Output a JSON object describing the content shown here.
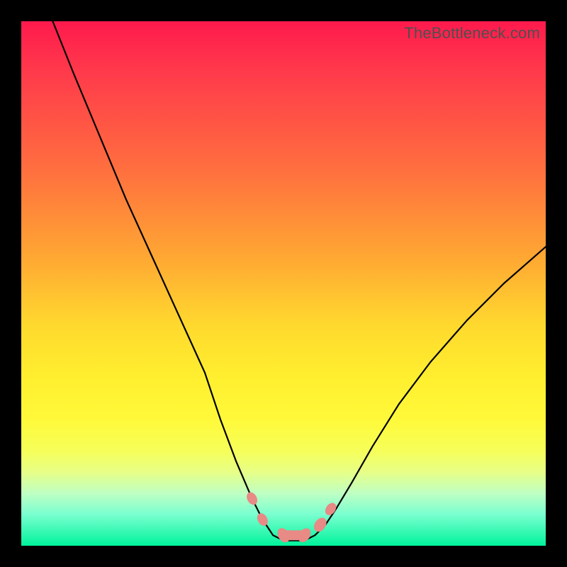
{
  "watermark": "TheBottleneck.com",
  "chart_data": {
    "type": "line",
    "title": "",
    "xlabel": "",
    "ylabel": "",
    "xlim": [
      0,
      100
    ],
    "ylim": [
      0,
      100
    ],
    "series": [
      {
        "name": "bottleneck-curve",
        "x": [
          6,
          10,
          15,
          20,
          25,
          30,
          35,
          38,
          41,
          44,
          46,
          48,
          50,
          52,
          54,
          56,
          58,
          60,
          63,
          67,
          72,
          78,
          85,
          92,
          100
        ],
        "values": [
          100,
          90,
          78,
          66,
          55,
          44,
          33,
          24,
          16,
          9,
          5,
          2,
          1,
          1,
          1,
          2,
          4,
          7,
          12,
          19,
          27,
          35,
          43,
          50,
          57
        ]
      }
    ],
    "markers": {
      "name": "highlight-band",
      "color": "#e88a85",
      "points": [
        {
          "x": 44,
          "y": 9
        },
        {
          "x": 46,
          "y": 5
        },
        {
          "x": 50,
          "y": 2
        },
        {
          "x": 54,
          "y": 2
        },
        {
          "x": 57,
          "y": 4
        },
        {
          "x": 59,
          "y": 7
        }
      ]
    },
    "background_gradient": {
      "top": "#ff1a4d",
      "mid": "#ffe433",
      "bottom": "#00f39b"
    }
  }
}
